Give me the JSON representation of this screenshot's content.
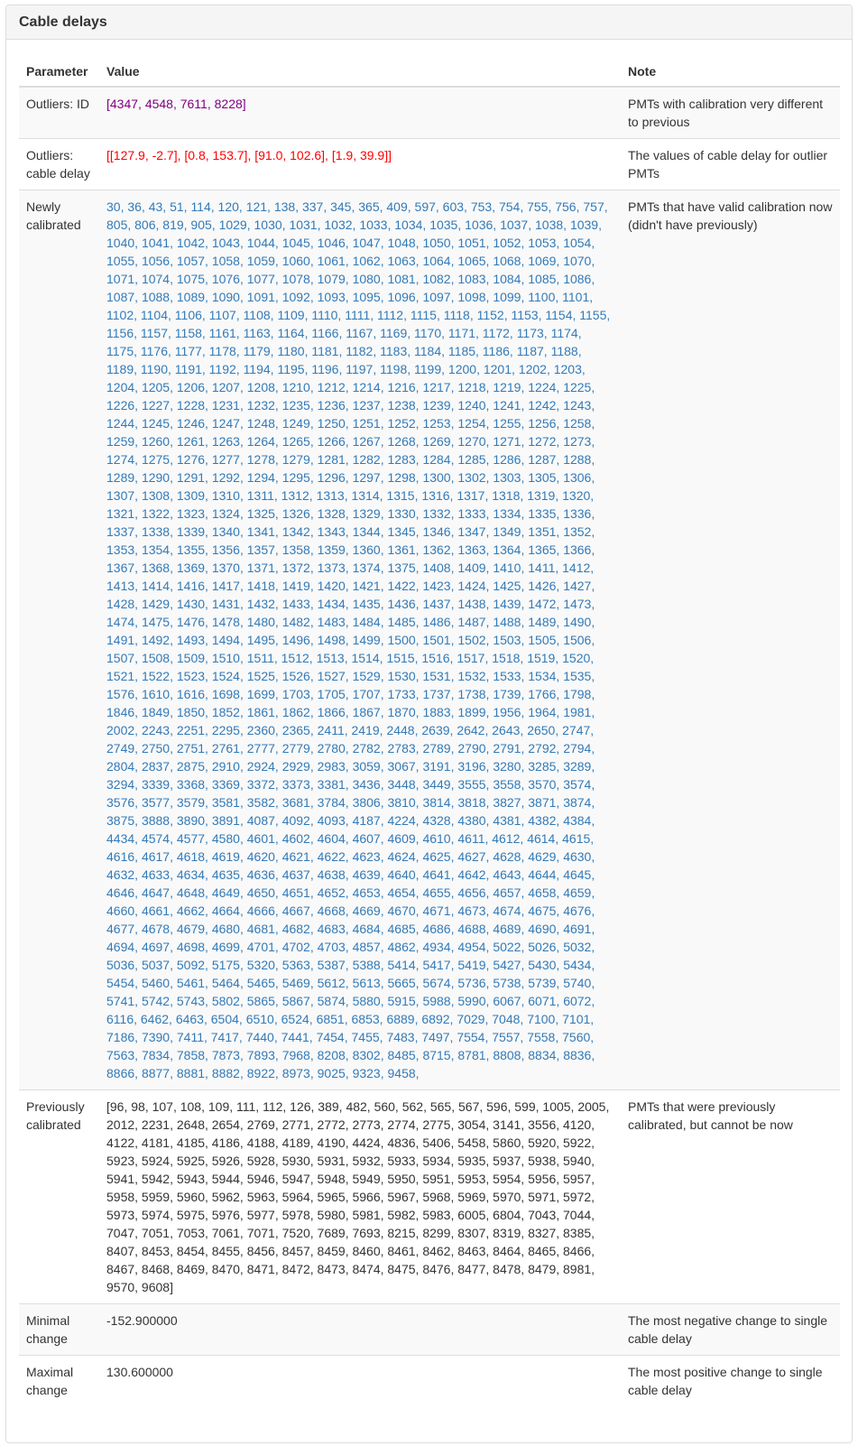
{
  "panel": {
    "title": "Cable delays"
  },
  "table": {
    "headers": {
      "parameter": "Parameter",
      "value": "Value",
      "note": "Note"
    },
    "rows": {
      "outliers_id": {
        "parameter": "Outliers: ID",
        "value": "[4347, 4548, 7611, 8228]",
        "note": "PMTs with calibration very different to previous",
        "color": "#800080"
      },
      "outliers_delay": {
        "parameter": "Outliers: cable delay",
        "value": "[[127.9, -2.7], [0.8, 153.7], [91.0, 102.6], [1.9, 39.9]]",
        "note": "The values of cable delay for outlier PMTs",
        "color": "#ff0000"
      },
      "newly": {
        "parameter": "Newly calibrated",
        "note": "PMTs that have valid calibration now (didn't have previously)",
        "color": "#337ab7",
        "ids": [
          30,
          36,
          43,
          51,
          114,
          120,
          121,
          138,
          337,
          345,
          365,
          409,
          597,
          603,
          753,
          754,
          755,
          756,
          757,
          805,
          806,
          819,
          905,
          1029,
          1030,
          1031,
          1032,
          1033,
          1034,
          1035,
          1036,
          1037,
          1038,
          1039,
          1040,
          1041,
          1042,
          1043,
          1044,
          1045,
          1046,
          1047,
          1048,
          1050,
          1051,
          1052,
          1053,
          1054,
          1055,
          1056,
          1057,
          1058,
          1059,
          1060,
          1061,
          1062,
          1063,
          1064,
          1065,
          1068,
          1069,
          1070,
          1071,
          1074,
          1075,
          1076,
          1077,
          1078,
          1079,
          1080,
          1081,
          1082,
          1083,
          1084,
          1085,
          1086,
          1087,
          1088,
          1089,
          1090,
          1091,
          1092,
          1093,
          1095,
          1096,
          1097,
          1098,
          1099,
          1100,
          1101,
          1102,
          1104,
          1106,
          1107,
          1108,
          1109,
          1110,
          1111,
          1112,
          1115,
          1118,
          1152,
          1153,
          1154,
          1155,
          1156,
          1157,
          1158,
          1161,
          1163,
          1164,
          1166,
          1167,
          1169,
          1170,
          1171,
          1172,
          1173,
          1174,
          1175,
          1176,
          1177,
          1178,
          1179,
          1180,
          1181,
          1182,
          1183,
          1184,
          1185,
          1186,
          1187,
          1188,
          1189,
          1190,
          1191,
          1192,
          1194,
          1195,
          1196,
          1197,
          1198,
          1199,
          1200,
          1201,
          1202,
          1203,
          1204,
          1205,
          1206,
          1207,
          1208,
          1210,
          1212,
          1214,
          1216,
          1217,
          1218,
          1219,
          1224,
          1225,
          1226,
          1227,
          1228,
          1231,
          1232,
          1235,
          1236,
          1237,
          1238,
          1239,
          1240,
          1241,
          1242,
          1243,
          1244,
          1245,
          1246,
          1247,
          1248,
          1249,
          1250,
          1251,
          1252,
          1253,
          1254,
          1255,
          1256,
          1258,
          1259,
          1260,
          1261,
          1263,
          1264,
          1265,
          1266,
          1267,
          1268,
          1269,
          1270,
          1271,
          1272,
          1273,
          1274,
          1275,
          1276,
          1277,
          1278,
          1279,
          1281,
          1282,
          1283,
          1284,
          1285,
          1286,
          1287,
          1288,
          1289,
          1290,
          1291,
          1292,
          1294,
          1295,
          1296,
          1297,
          1298,
          1300,
          1302,
          1303,
          1305,
          1306,
          1307,
          1308,
          1309,
          1310,
          1311,
          1312,
          1313,
          1314,
          1315,
          1316,
          1317,
          1318,
          1319,
          1320,
          1321,
          1322,
          1323,
          1324,
          1325,
          1326,
          1328,
          1329,
          1330,
          1332,
          1333,
          1334,
          1335,
          1336,
          1337,
          1338,
          1339,
          1340,
          1341,
          1342,
          1343,
          1344,
          1345,
          1346,
          1347,
          1349,
          1351,
          1352,
          1353,
          1354,
          1355,
          1356,
          1357,
          1358,
          1359,
          1360,
          1361,
          1362,
          1363,
          1364,
          1365,
          1366,
          1367,
          1368,
          1369,
          1370,
          1371,
          1372,
          1373,
          1374,
          1375,
          1408,
          1409,
          1410,
          1411,
          1412,
          1413,
          1414,
          1416,
          1417,
          1418,
          1419,
          1420,
          1421,
          1422,
          1423,
          1424,
          1425,
          1426,
          1427,
          1428,
          1429,
          1430,
          1431,
          1432,
          1433,
          1434,
          1435,
          1436,
          1437,
          1438,
          1439,
          1472,
          1473,
          1474,
          1475,
          1476,
          1478,
          1480,
          1482,
          1483,
          1484,
          1485,
          1486,
          1487,
          1488,
          1489,
          1490,
          1491,
          1492,
          1493,
          1494,
          1495,
          1496,
          1498,
          1499,
          1500,
          1501,
          1502,
          1503,
          1505,
          1506,
          1507,
          1508,
          1509,
          1510,
          1511,
          1512,
          1513,
          1514,
          1515,
          1516,
          1517,
          1518,
          1519,
          1520,
          1521,
          1522,
          1523,
          1524,
          1525,
          1526,
          1527,
          1529,
          1530,
          1531,
          1532,
          1533,
          1534,
          1535,
          1576,
          1610,
          1616,
          1698,
          1699,
          1703,
          1705,
          1707,
          1733,
          1737,
          1738,
          1739,
          1766,
          1798,
          1846,
          1849,
          1850,
          1852,
          1861,
          1862,
          1866,
          1867,
          1870,
          1883,
          1899,
          1956,
          1964,
          1981,
          2002,
          2243,
          2251,
          2295,
          2360,
          2365,
          2411,
          2419,
          2448,
          2639,
          2642,
          2643,
          2650,
          2747,
          2749,
          2750,
          2751,
          2761,
          2777,
          2779,
          2780,
          2782,
          2783,
          2789,
          2790,
          2791,
          2792,
          2794,
          2804,
          2837,
          2875,
          2910,
          2924,
          2929,
          2983,
          3059,
          3067,
          3191,
          3196,
          3280,
          3285,
          3289,
          3294,
          3339,
          3368,
          3369,
          3372,
          3373,
          3381,
          3436,
          3448,
          3449,
          3555,
          3558,
          3570,
          3574,
          3576,
          3577,
          3579,
          3581,
          3582,
          3681,
          3784,
          3806,
          3810,
          3814,
          3818,
          3827,
          3871,
          3874,
          3875,
          3888,
          3890,
          3891,
          4087,
          4092,
          4093,
          4187,
          4224,
          4328,
          4380,
          4381,
          4382,
          4384,
          4434,
          4574,
          4577,
          4580,
          4601,
          4602,
          4604,
          4607,
          4609,
          4610,
          4611,
          4612,
          4614,
          4615,
          4616,
          4617,
          4618,
          4619,
          4620,
          4621,
          4622,
          4623,
          4624,
          4625,
          4627,
          4628,
          4629,
          4630,
          4632,
          4633,
          4634,
          4635,
          4636,
          4637,
          4638,
          4639,
          4640,
          4641,
          4642,
          4643,
          4644,
          4645,
          4646,
          4647,
          4648,
          4649,
          4650,
          4651,
          4652,
          4653,
          4654,
          4655,
          4656,
          4657,
          4658,
          4659,
          4660,
          4661,
          4662,
          4664,
          4666,
          4667,
          4668,
          4669,
          4670,
          4671,
          4673,
          4674,
          4675,
          4676,
          4677,
          4678,
          4679,
          4680,
          4681,
          4682,
          4683,
          4684,
          4685,
          4686,
          4688,
          4689,
          4690,
          4691,
          4694,
          4697,
          4698,
          4699,
          4701,
          4702,
          4703,
          4857,
          4862,
          4934,
          4954,
          5022,
          5026,
          5032,
          5036,
          5037,
          5092,
          5175,
          5320,
          5363,
          5387,
          5388,
          5414,
          5417,
          5419,
          5427,
          5430,
          5434,
          5454,
          5460,
          5461,
          5464,
          5465,
          5469,
          5612,
          5613,
          5665,
          5674,
          5736,
          5738,
          5739,
          5740,
          5741,
          5742,
          5743,
          5802,
          5865,
          5867,
          5874,
          5880,
          5915,
          5988,
          5990,
          6067,
          6071,
          6072,
          6116,
          6462,
          6463,
          6504,
          6510,
          6524,
          6851,
          6853,
          6889,
          6892,
          7029,
          7048,
          7100,
          7101,
          7186,
          7390,
          7411,
          7417,
          7440,
          7441,
          7454,
          7455,
          7483,
          7497,
          7554,
          7557,
          7558,
          7560,
          7563,
          7834,
          7858,
          7873,
          7893,
          7968,
          8208,
          8302,
          8485,
          8715,
          8781,
          8808,
          8834,
          8836,
          8866,
          8877,
          8881,
          8882,
          8922,
          8973,
          9025,
          9323,
          9458
        ]
      },
      "previously": {
        "parameter": "Previously calibrated",
        "value": "[96, 98, 107, 108, 109, 111, 112, 126, 389, 482, 560, 562, 565, 567, 596, 599, 1005, 2005, 2012, 2231, 2648, 2654, 2769, 2771, 2772, 2773, 2774, 2775, 3054, 3141, 3556, 4120, 4122, 4181, 4185, 4186, 4188, 4189, 4190, 4424, 4836, 5406, 5458, 5860, 5920, 5922, 5923, 5924, 5925, 5926, 5928, 5930, 5931, 5932, 5933, 5934, 5935, 5937, 5938, 5940, 5941, 5942, 5943, 5944, 5946, 5947, 5948, 5949, 5950, 5951, 5953, 5954, 5956, 5957, 5958, 5959, 5960, 5962, 5963, 5964, 5965, 5966, 5967, 5968, 5969, 5970, 5971, 5972, 5973, 5974, 5975, 5976, 5977, 5978, 5980, 5981, 5982, 5983, 6005, 6804, 7043, 7044, 7047, 7051, 7053, 7061, 7071, 7520, 7689, 7693, 8215, 8299, 8307, 8319, 8327, 8385, 8407, 8453, 8454, 8455, 8456, 8457, 8459, 8460, 8461, 8462, 8463, 8464, 8465, 8466, 8467, 8468, 8469, 8470, 8471, 8472, 8473, 8474, 8475, 8476, 8477, 8478, 8479, 8981, 9570, 9608]",
        "note": "PMTs that were previously calibrated, but cannot be now",
        "color": "#333333"
      },
      "minimal": {
        "parameter": "Minimal change",
        "value": "-152.900000",
        "note": "The most negative change to single cable delay"
      },
      "maximal": {
        "parameter": "Maximal change",
        "value": "130.600000",
        "note": "The most positive change to single cable delay"
      }
    }
  }
}
